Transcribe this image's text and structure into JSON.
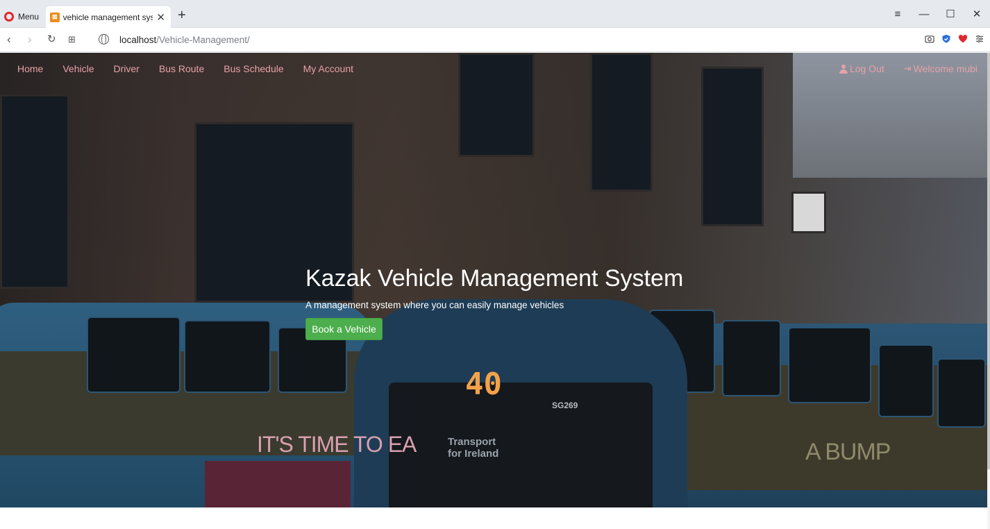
{
  "browser": {
    "menu_label": "Menu",
    "tab_title": "vehicle management system",
    "url_host": "localhost",
    "url_path": "/Vehicle-Management/"
  },
  "nav": {
    "left": [
      "Home",
      "Vehicle",
      "Driver",
      "Bus Route",
      "Bus Schedule",
      "My Account"
    ],
    "logout": "Log Out",
    "welcome": "Welcome mubi"
  },
  "hero": {
    "title": "Kazak Vehicle Management System",
    "subtitle": "A management system where you can easily manage vehicles",
    "button": "Book a Vehicle"
  },
  "photo_text": {
    "route_number": "40",
    "registration": "SG269",
    "transport_line1": "Transport",
    "transport_line2": "for Ireland",
    "ad_text": "IT'S TIME TO EA",
    "bump_text": "A BUMP"
  },
  "colors": {
    "nav_link": "#e6a1a8",
    "button_bg": "#4cae4c",
    "opera_red": "#e0272d"
  }
}
